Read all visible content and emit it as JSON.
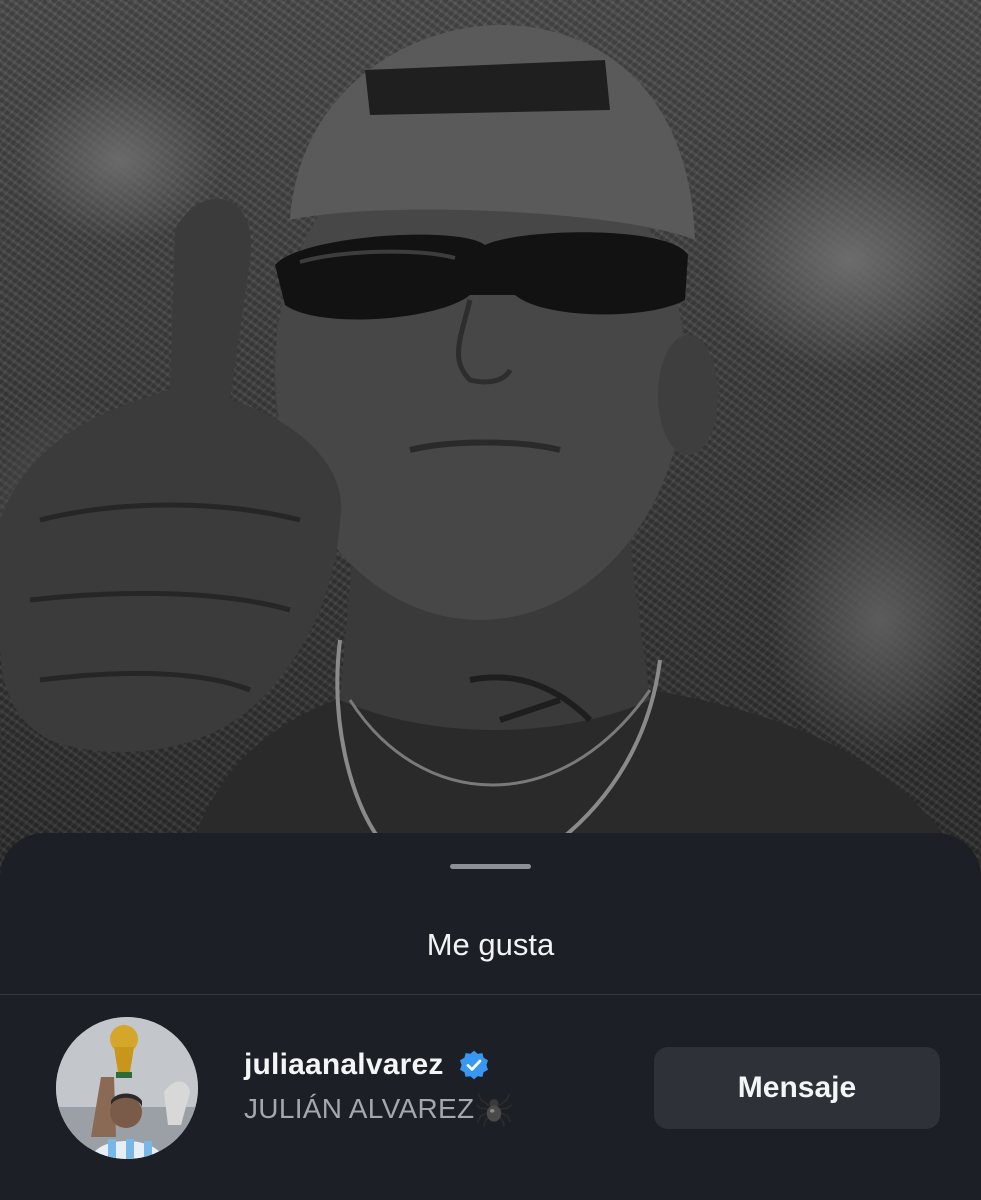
{
  "sheet": {
    "title": "Me gusta"
  },
  "liker": {
    "username": "juliaanalvarez",
    "full_name": "JULIÁN ALVAREZ",
    "verified": true,
    "message_button_label": "Mensaje",
    "name_suffix_icon": "spider-icon",
    "avatar_description_icon": "avatar"
  },
  "colors": {
    "sheet_background": "#1c1f25",
    "verified_blue": "#3897f0",
    "button_background": "#2e3138"
  }
}
